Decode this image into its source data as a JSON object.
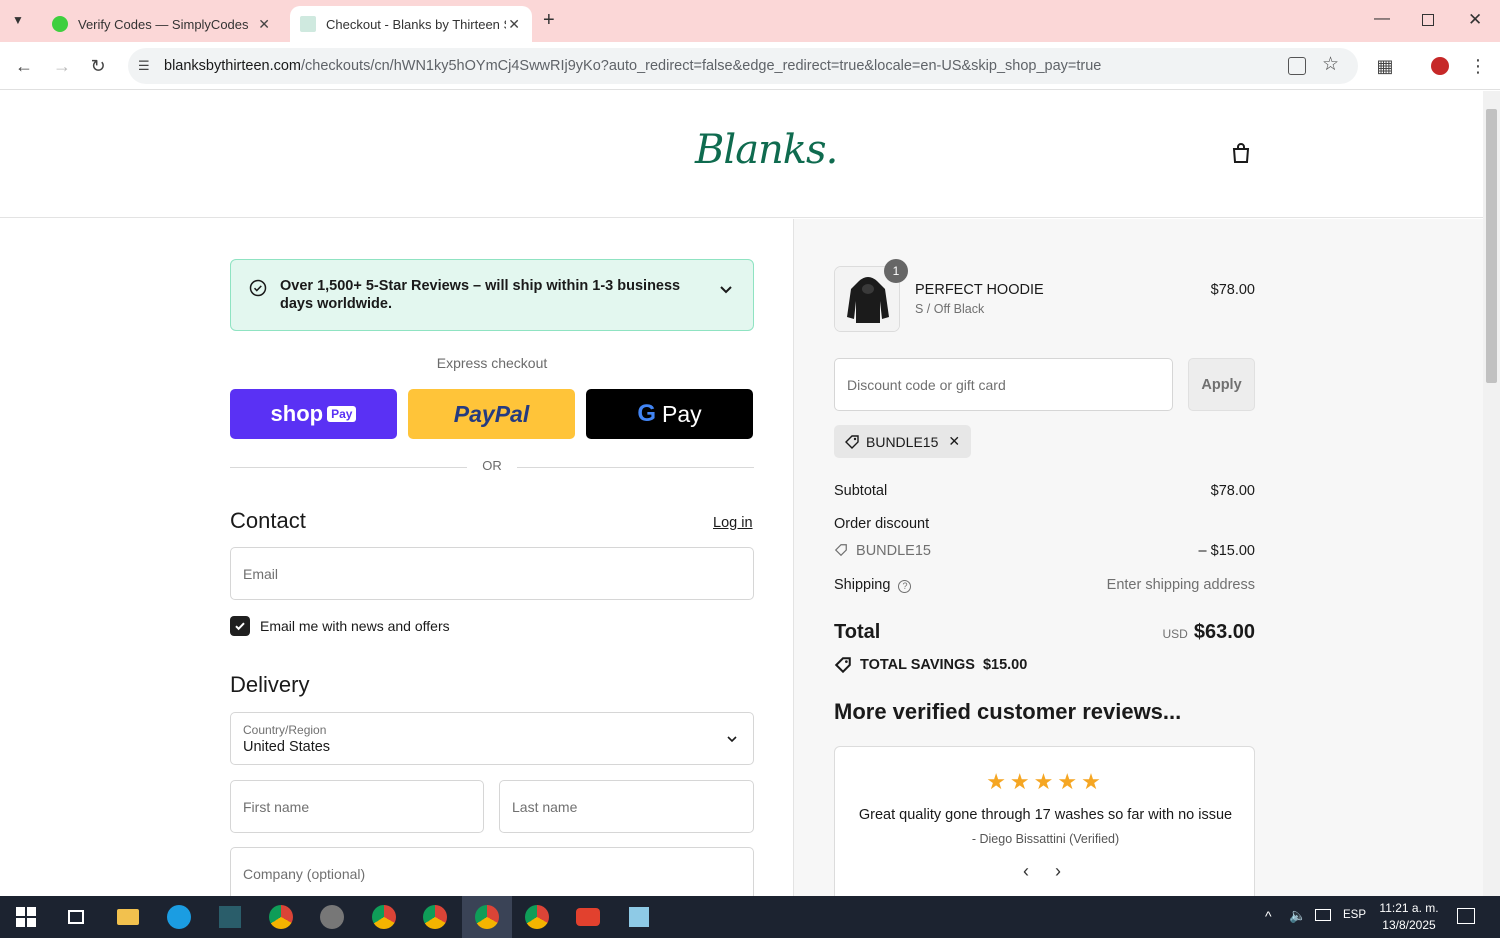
{
  "browser": {
    "tabs": [
      {
        "title": "Verify Codes — SimplyCodes",
        "active": false
      },
      {
        "title": "Checkout - Blanks by Thirteen S",
        "active": true
      }
    ],
    "url_host": "blanksbythirteen.com",
    "url_path": "/checkouts/cn/hWN1ky5hOYmCj4SwwRIj9yKo?auto_redirect=false&edge_redirect=true&locale=en-US&skip_shop_pay=true"
  },
  "header": {
    "logo_text": "Blanks."
  },
  "banner": {
    "text": "Over 1,500+ 5-Star Reviews – will ship within 1-3 business days worldwide."
  },
  "express": {
    "label": "Express checkout",
    "shop_pay": "shop",
    "shop_pay_badge": "Pay",
    "paypal": "PayPal",
    "gpay": "Pay",
    "or_label": "OR"
  },
  "contact": {
    "title": "Contact",
    "login_label": "Log in",
    "email_placeholder": "Email",
    "newsletter_label": "Email me with news and offers"
  },
  "delivery": {
    "title": "Delivery",
    "country_label": "Country/Region",
    "country_value": "United States",
    "first_name_placeholder": "First name",
    "last_name_placeholder": "Last name",
    "company_placeholder": "Company (optional)"
  },
  "order": {
    "quantity": "1",
    "product_name": "PERFECT HOODIE",
    "product_variant": "S / Off Black",
    "product_price": "$78.00",
    "discount_placeholder": "Discount code or gift card",
    "apply_label": "Apply",
    "applied_code": "BUNDLE15",
    "subtotal_label": "Subtotal",
    "subtotal_value": "$78.00",
    "order_discount_label": "Order discount",
    "discount_code": "BUNDLE15",
    "discount_value": "– $15.00",
    "shipping_label": "Shipping",
    "shipping_value": "Enter shipping address",
    "total_label": "Total",
    "total_currency": "USD",
    "total_value": "$63.00",
    "savings_label": "TOTAL SAVINGS",
    "savings_value": "$15.00"
  },
  "reviews": {
    "title": "More verified customer reviews...",
    "rating": 5,
    "text": "Great quality gone through 17 washes so far with no issue",
    "author": "- Diego Bissattini (Verified)"
  },
  "taskbar": {
    "language": "ESP",
    "time": "11:21 a. m.",
    "date": "13/8/2025"
  },
  "colors": {
    "brand_green": "#0f6b4f",
    "banner_bg": "#e3f7ef",
    "shop_pay": "#5a31f4",
    "paypal": "#ffc439",
    "tab_bar": "#fbd7d7",
    "stars": "#f5a623"
  }
}
